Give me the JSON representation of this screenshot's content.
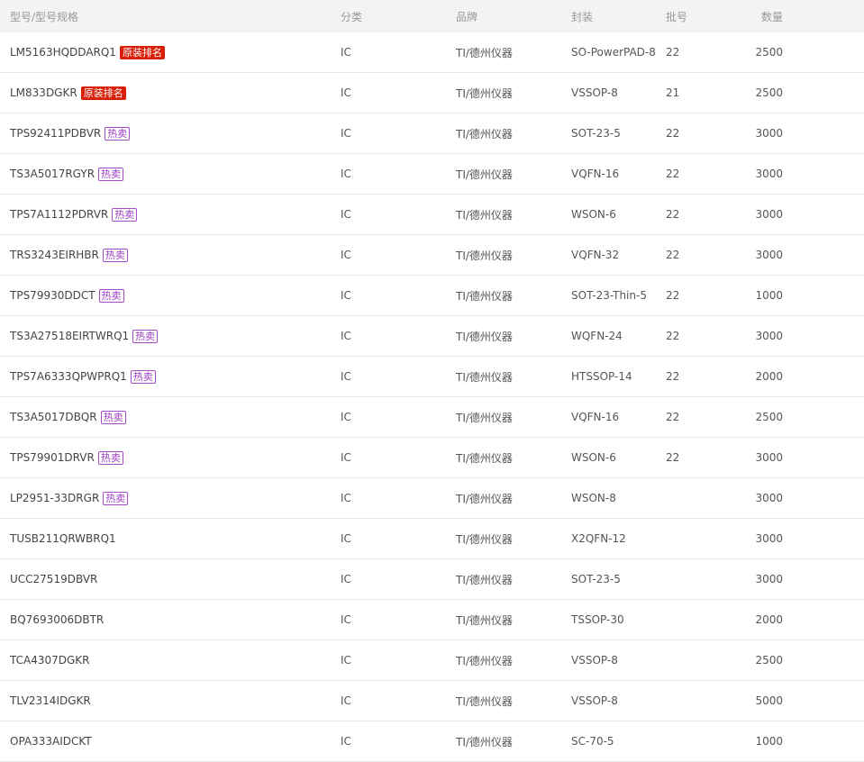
{
  "header": {
    "model": "型号/型号规格",
    "category": "分类",
    "brand": "品牌",
    "package": "封装",
    "batch": "批号",
    "quantity": "数量"
  },
  "colors": {
    "tag_original_bg": "#d81e06",
    "tag_hot_border": "#a54cc9",
    "header_bg": "#f3f3f3"
  },
  "rows": [
    {
      "model": "LM5163HQDDARQ1",
      "tag": "原装排名",
      "tag_type": "original",
      "category": "IC",
      "brand": "TI/德州仪器",
      "package": "SO-PowerPAD-8",
      "batch": "22",
      "quantity": "2500"
    },
    {
      "model": "LM833DGKR",
      "tag": "原装排名",
      "tag_type": "original",
      "category": "IC",
      "brand": "TI/德州仪器",
      "package": "VSSOP-8",
      "batch": "21",
      "quantity": "2500"
    },
    {
      "model": "TPS92411PDBVR",
      "tag": "热卖",
      "tag_type": "hot",
      "category": "IC",
      "brand": "TI/德州仪器",
      "package": "SOT-23-5",
      "batch": "22",
      "quantity": "3000"
    },
    {
      "model": "TS3A5017RGYR",
      "tag": "热卖",
      "tag_type": "hot",
      "category": "IC",
      "brand": "TI/德州仪器",
      "package": "VQFN-16",
      "batch": "22",
      "quantity": "3000"
    },
    {
      "model": "TPS7A1112PDRVR",
      "tag": "热卖",
      "tag_type": "hot",
      "category": "IC",
      "brand": "TI/德州仪器",
      "package": "WSON-6",
      "batch": "22",
      "quantity": "3000"
    },
    {
      "model": "TRS3243EIRHBR",
      "tag": "热卖",
      "tag_type": "hot",
      "category": "IC",
      "brand": "TI/德州仪器",
      "package": "VQFN-32",
      "batch": "22",
      "quantity": "3000"
    },
    {
      "model": "TPS79930DDCT",
      "tag": "热卖",
      "tag_type": "hot",
      "category": "IC",
      "brand": "TI/德州仪器",
      "package": "SOT-23-Thin-5",
      "batch": "22",
      "quantity": "1000"
    },
    {
      "model": "TS3A27518EIRTWRQ1",
      "tag": "热卖",
      "tag_type": "hot",
      "category": "IC",
      "brand": "TI/德州仪器",
      "package": "WQFN-24",
      "batch": "22",
      "quantity": "3000"
    },
    {
      "model": "TPS7A6333QPWPRQ1",
      "tag": "热卖",
      "tag_type": "hot",
      "category": "IC",
      "brand": "TI/德州仪器",
      "package": "HTSSOP-14",
      "batch": "22",
      "quantity": "2000"
    },
    {
      "model": "TS3A5017DBQR",
      "tag": "热卖",
      "tag_type": "hot",
      "category": "IC",
      "brand": "TI/德州仪器",
      "package": "VQFN-16",
      "batch": "22",
      "quantity": "2500"
    },
    {
      "model": "TPS79901DRVR",
      "tag": "热卖",
      "tag_type": "hot",
      "category": "IC",
      "brand": "TI/德州仪器",
      "package": "WSON-6",
      "batch": "22",
      "quantity": "3000"
    },
    {
      "model": "LP2951-33DRGR",
      "tag": "热卖",
      "tag_type": "hot",
      "category": "IC",
      "brand": "TI/德州仪器",
      "package": "WSON-8",
      "batch": "",
      "quantity": "3000"
    },
    {
      "model": "TUSB211QRWBRQ1",
      "tag": "",
      "tag_type": "",
      "category": "IC",
      "brand": "TI/德州仪器",
      "package": "X2QFN-12",
      "batch": "",
      "quantity": "3000"
    },
    {
      "model": "UCC27519DBVR",
      "tag": "",
      "tag_type": "",
      "category": "IC",
      "brand": "TI/德州仪器",
      "package": "SOT-23-5",
      "batch": "",
      "quantity": "3000"
    },
    {
      "model": "BQ7693006DBTR",
      "tag": "",
      "tag_type": "",
      "category": "IC",
      "brand": "TI/德州仪器",
      "package": "TSSOP-30",
      "batch": "",
      "quantity": "2000"
    },
    {
      "model": "TCA4307DGKR",
      "tag": "",
      "tag_type": "",
      "category": "IC",
      "brand": "TI/德州仪器",
      "package": "VSSOP-8",
      "batch": "",
      "quantity": "2500"
    },
    {
      "model": "TLV2314IDGKR",
      "tag": "",
      "tag_type": "",
      "category": "IC",
      "brand": "TI/德州仪器",
      "package": "VSSOP-8",
      "batch": "",
      "quantity": "5000"
    },
    {
      "model": "OPA333AIDCKT",
      "tag": "",
      "tag_type": "",
      "category": "IC",
      "brand": "TI/德州仪器",
      "package": "SC-70-5",
      "batch": "",
      "quantity": "1000"
    }
  ]
}
